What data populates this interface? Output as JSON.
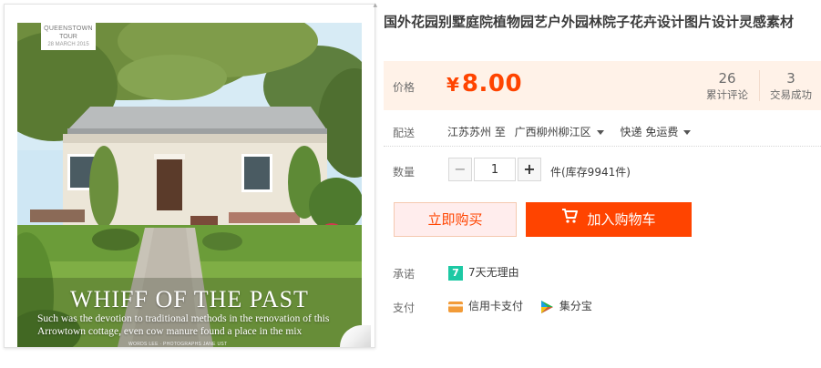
{
  "product": {
    "title": "国外花园别墅庭院植物园艺户外园林院子花卉设计图片设计灵感素材",
    "image": {
      "badge_line1": "QUEENSTOWN",
      "badge_line2": "TOUR",
      "badge_line3": "28 MARCH 2015",
      "headline": "WHIFF OF THE PAST",
      "subline": "Such was the devotion to traditional methods in the renovation of this Arrowtown cottage, even cow manure found a place in the mix",
      "credits": "WORDS LEE · PHOTOGRAPHS JANE UST"
    }
  },
  "price": {
    "label": "价格",
    "symbol": "¥",
    "value": "8.00",
    "reviews_count": "26",
    "reviews_label": "累计评论",
    "sales_count": "3",
    "sales_label": "交易成功"
  },
  "shipping": {
    "label": "配送",
    "from": "江苏苏州 至",
    "to": "广西柳州柳江区",
    "method": "快递 免运费"
  },
  "quantity": {
    "label": "数量",
    "minus": "−",
    "value": "1",
    "plus": "+",
    "stock_text": "件(库存9941件)"
  },
  "actions": {
    "buy_now": "立即购买",
    "add_to_cart": "加入购物车"
  },
  "promise": {
    "label": "承诺",
    "badge": "7",
    "text": "7天无理由"
  },
  "payment": {
    "label": "支付",
    "methods": [
      "信用卡支付",
      "集分宝"
    ]
  },
  "colors": {
    "accent": "#ff4400",
    "price_bg": "#fff2e8",
    "buy_now_bg": "#ffeded",
    "promise_badge": "#1dc9a4"
  },
  "icons": [
    "cart-icon",
    "credit-card-icon",
    "jifenbao-icon",
    "caret-down-icon"
  ]
}
